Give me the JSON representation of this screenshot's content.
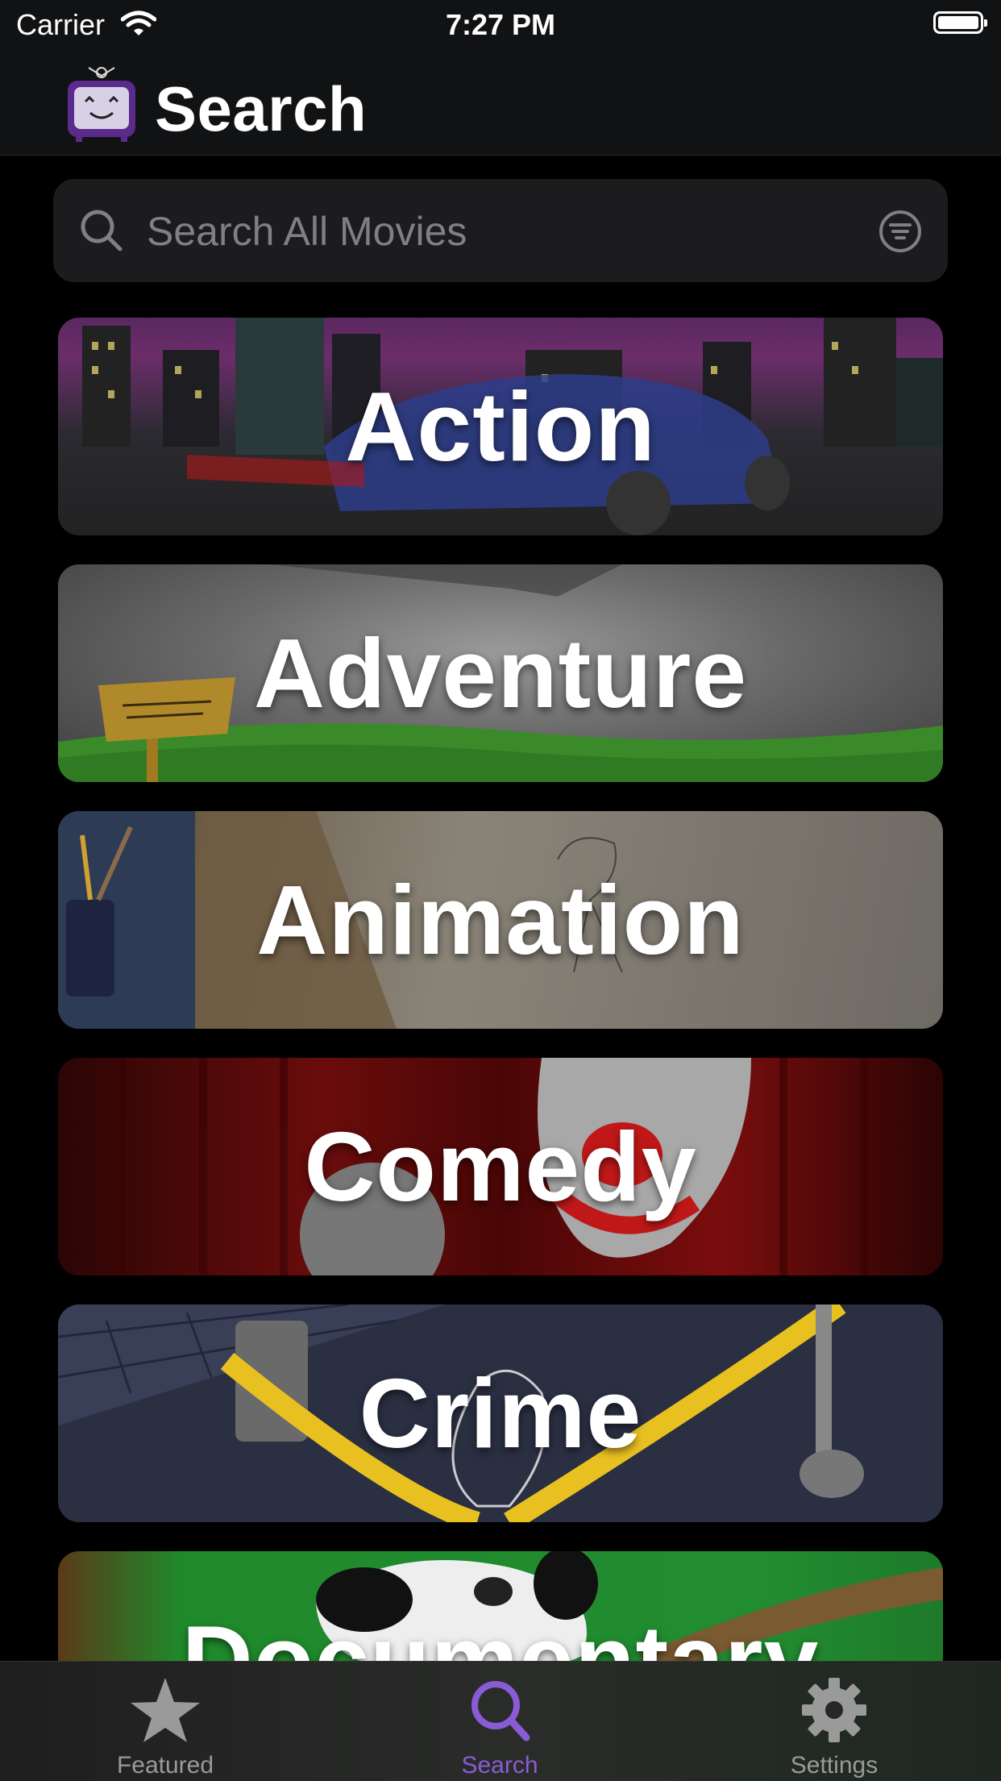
{
  "status_bar": {
    "carrier": "Carrier",
    "time": "7:27 PM"
  },
  "nav": {
    "title": "Search",
    "logo_icon": "tv-robot-icon"
  },
  "search": {
    "placeholder": "Search All Movies",
    "search_icon": "magnifier-icon",
    "filter_icon": "filter-lines-icon"
  },
  "categories": [
    {
      "label": "Action"
    },
    {
      "label": "Adventure"
    },
    {
      "label": "Animation"
    },
    {
      "label": "Comedy"
    },
    {
      "label": "Crime"
    },
    {
      "label": "Documentary"
    }
  ],
  "tabs": [
    {
      "label": "Featured",
      "icon": "star-icon",
      "active": false
    },
    {
      "label": "Search",
      "icon": "magnifier-icon",
      "active": true
    },
    {
      "label": "Settings",
      "icon": "gear-icon",
      "active": false
    }
  ],
  "colors": {
    "accent": "#8a5bd6",
    "inactive_tab": "#9a9a9a",
    "background": "#000000",
    "search_field": "#1c1c1e"
  }
}
